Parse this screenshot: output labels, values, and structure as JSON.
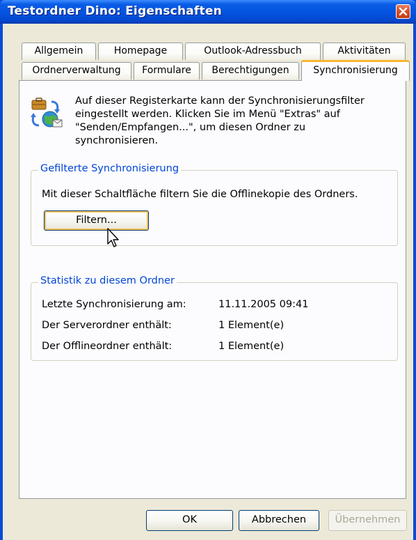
{
  "window": {
    "title": "Testordner Dino: Eigenschaften"
  },
  "tabs": {
    "row1": [
      "Allgemein",
      "Homepage",
      "Outlook-Adressbuch",
      "Aktivitäten"
    ],
    "row2": [
      "Ordnerverwaltung",
      "Formulare",
      "Berechtigungen",
      "Synchronisierung"
    ],
    "active": "Synchronisierung"
  },
  "intro": {
    "lines": [
      "Auf dieser Registerkarte kann der Synchronisierungsfilter",
      "eingestellt werden. Klicken Sie im Menü \"Extras\" auf",
      "\"Senden/Empfangen...\", um diesen Ordner zu",
      "synchronisieren."
    ]
  },
  "filter_group": {
    "legend": "Gefilterte Synchronisierung",
    "text": "Mit dieser Schaltfläche filtern Sie die Offlinekopie des Ordners.",
    "button": "Filtern..."
  },
  "stats_group": {
    "legend": "Statistik zu diesem Ordner",
    "rows": [
      {
        "label": "Letzte Synchronisierung am:",
        "value": "11.11.2005 09:41"
      },
      {
        "label": "Der Serverordner enthält:",
        "value": "1 Element(e)"
      },
      {
        "label": "Der Offlineordner enthält:",
        "value": "1 Element(e)"
      }
    ]
  },
  "footer": {
    "ok": "OK",
    "cancel": "Abbrechen",
    "apply": "Übernehmen"
  },
  "icons": [
    "close-icon",
    "sync-icon",
    "mouse-pointer-icon"
  ],
  "colors": {
    "titlebar": "#0a5ce6",
    "dialog_bg": "#ece9d8",
    "group_legend": "#0046d5",
    "active_tab_highlight": "#f9b533"
  }
}
